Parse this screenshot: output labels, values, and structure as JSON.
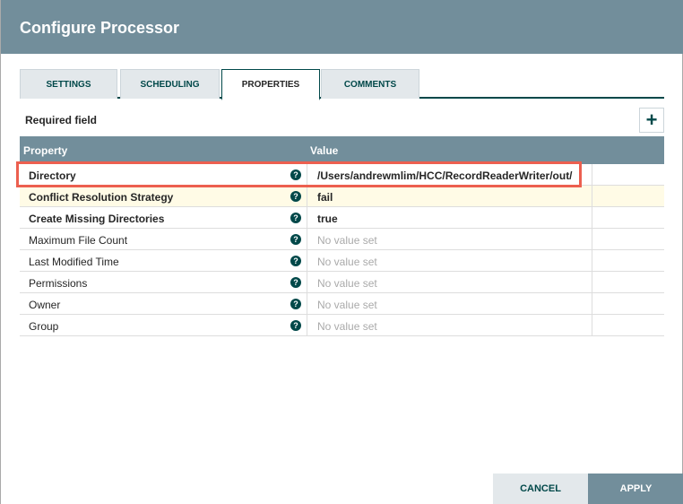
{
  "dialog": {
    "title": "Configure Processor"
  },
  "tabs": [
    {
      "label": "SETTINGS"
    },
    {
      "label": "SCHEDULING"
    },
    {
      "label": "PROPERTIES",
      "active": true
    },
    {
      "label": "COMMENTS"
    }
  ],
  "required_label": "Required field",
  "add_icon": "plus-icon",
  "table": {
    "headers": [
      "Property",
      "Value"
    ],
    "rows": [
      {
        "property": "Directory",
        "value": "/Users/andrewmlim/HCC/RecordReaderWriter/out/",
        "required": true,
        "set": true
      },
      {
        "property": "Conflict Resolution Strategy",
        "value": "fail",
        "required": true,
        "set": true
      },
      {
        "property": "Create Missing Directories",
        "value": "true",
        "required": true,
        "set": true
      },
      {
        "property": "Maximum File Count",
        "value": "No value set",
        "required": false,
        "set": false
      },
      {
        "property": "Last Modified Time",
        "value": "No value set",
        "required": false,
        "set": false
      },
      {
        "property": "Permissions",
        "value": "No value set",
        "required": false,
        "set": false
      },
      {
        "property": "Owner",
        "value": "No value set",
        "required": false,
        "set": false
      },
      {
        "property": "Group",
        "value": "No value set",
        "required": false,
        "set": false
      }
    ]
  },
  "buttons": {
    "cancel": "CANCEL",
    "apply": "APPLY"
  },
  "colors": {
    "header": "#728e9b",
    "accent": "#004849",
    "highlight": "#ec5f4f"
  }
}
